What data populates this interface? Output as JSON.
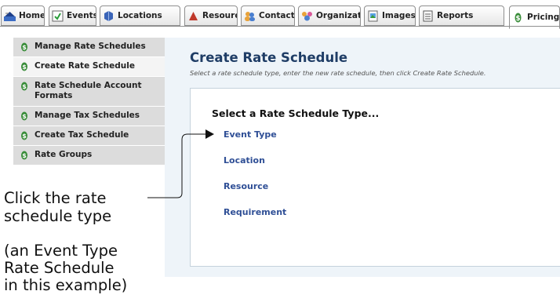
{
  "tabs": [
    {
      "label": "Home",
      "icon": "home-icon"
    },
    {
      "label": "Events",
      "icon": "events-icon"
    },
    {
      "label": "Locations",
      "icon": "locations-icon"
    },
    {
      "label": "Resources",
      "icon": "resources-icon"
    },
    {
      "label": "Contacts",
      "icon": "contacts-icon"
    },
    {
      "label": "Organizat",
      "icon": "organizations-icon"
    },
    {
      "label": "Images",
      "icon": "images-icon"
    },
    {
      "label": "Reports",
      "icon": "reports-icon"
    },
    {
      "label": "Pricing",
      "icon": "pricing-icon",
      "active": true
    }
  ],
  "sidebar": {
    "items": [
      {
        "label": "Manage Rate Schedules"
      },
      {
        "label": "Create Rate Schedule",
        "selected": true
      },
      {
        "label": "Rate Schedule Account Formats"
      },
      {
        "label": "Manage Tax Schedules"
      },
      {
        "label": "Create Tax Schedule"
      },
      {
        "label": "Rate Groups"
      }
    ]
  },
  "main": {
    "title": "Create Rate Schedule",
    "subtitle": "Select a rate schedule type, enter the new rate schedule, then click Create Rate Schedule.",
    "box_heading": "Select a Rate Schedule Type...",
    "options": [
      "Event Type",
      "Location",
      "Resource",
      "Requirement"
    ]
  },
  "annotation": {
    "callout": [
      "Click the rate",
      "schedule type"
    ],
    "note": [
      "(an Event Type",
      "Rate Schedule",
      "in this example)"
    ]
  },
  "colors": {
    "accent_title": "#1f3d66",
    "link": "#2f4f96",
    "panel": "#eef4f9",
    "sidebar": "#dcdcdc"
  }
}
